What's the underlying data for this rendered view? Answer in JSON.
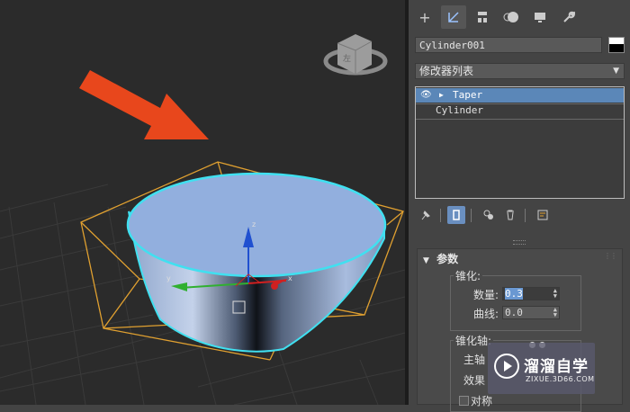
{
  "viewport": {
    "axis_labels": {
      "z": "z",
      "y": "y",
      "x": "x"
    },
    "viewcube_label": "左",
    "arrow_color": "#e8471c",
    "selection_color": "#40e0f0",
    "bbox_color": "#e0a030"
  },
  "command_panel": {
    "tabs": [
      "create-icon",
      "modify-icon",
      "hierarchy-icon",
      "motion-icon",
      "display-icon",
      "utilities-icon"
    ],
    "object_name": "Cylinder001",
    "modifier_list_label": "修改器列表",
    "stack": [
      {
        "label": "Taper",
        "selected": true
      },
      {
        "label": "Cylinder",
        "selected": false
      }
    ],
    "toolbar": [
      "pin-stack-icon",
      "show-end-result-icon",
      "make-unique-icon",
      "remove-modifier-icon",
      "configure-sets-icon"
    ],
    "rollout": {
      "title": "参数",
      "taper_group": "锥化:",
      "amount_label": "数量:",
      "amount_value": "0.3",
      "curve_label": "曲线:",
      "curve_value": "0.0",
      "axis_group": "锥化轴:",
      "primary_label": "主轴",
      "effect_label": "效果",
      "symmetry_label": "对称"
    }
  },
  "watermark": {
    "title": "溜溜自学",
    "url": "ZIXUE.3D66.COM"
  }
}
